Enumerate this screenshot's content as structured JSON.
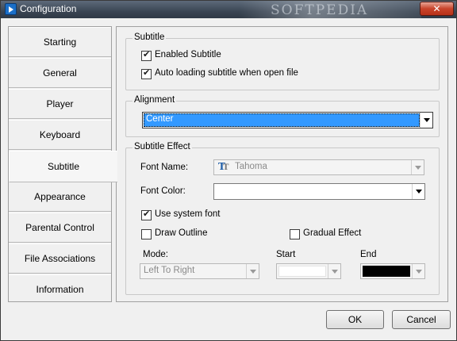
{
  "window": {
    "title": "Configuration",
    "watermark": "SOFTPEDIA",
    "close_glyph": "✕"
  },
  "nav": {
    "items": [
      {
        "label": "Starting"
      },
      {
        "label": "General"
      },
      {
        "label": "Player"
      },
      {
        "label": "Keyboard"
      },
      {
        "label": "Subtitle"
      },
      {
        "label": "Appearance"
      },
      {
        "label": "Parental Control"
      },
      {
        "label": "File Associations"
      },
      {
        "label": "Information"
      }
    ],
    "selected": "Subtitle"
  },
  "subtitle_group": {
    "title": "Subtitle",
    "enabled_label": "Enabled Subtitle",
    "enabled_checked": true,
    "auto_load_label": "Auto loading subtitle when open file",
    "auto_load_checked": true
  },
  "alignment_group": {
    "title": "Alignment",
    "selected": "Center"
  },
  "effect_group": {
    "title": "Subtitle Effect",
    "font_name_label": "Font Name:",
    "font_name_value": "Tahoma",
    "font_icon": "truetype-font-icon",
    "font_color_label": "Font Color:",
    "font_color_value": "#ffffff",
    "use_system_font_label": "Use system font",
    "use_system_font_checked": true,
    "draw_outline_label": "Draw Outline",
    "draw_outline_checked": false,
    "gradual_effect_label": "Gradual Effect",
    "gradual_effect_checked": false,
    "mode_label": "Mode:",
    "mode_value": "Left To Right",
    "start_label": "Start",
    "start_color": "#ffffff",
    "end_label": "End",
    "end_color": "#000000"
  },
  "buttons": {
    "ok": "OK",
    "cancel": "Cancel"
  },
  "colors": {
    "selection": "#3399ff",
    "title_bar": "#3b4654",
    "close": "#c8432a"
  }
}
